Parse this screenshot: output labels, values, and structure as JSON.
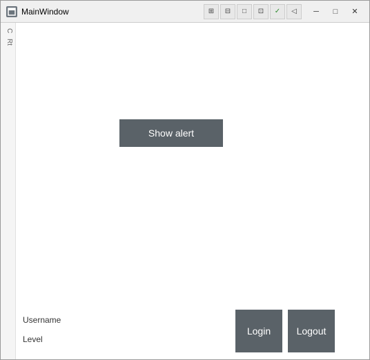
{
  "window": {
    "title": "MainWindow",
    "icon": "window-icon"
  },
  "toolbar": {
    "buttons": [
      {
        "label": "⊞",
        "name": "toolbar-btn-1"
      },
      {
        "label": "⊟",
        "name": "toolbar-btn-2"
      },
      {
        "label": "□",
        "name": "toolbar-btn-3"
      },
      {
        "label": "⊡",
        "name": "toolbar-btn-4"
      },
      {
        "label": "✓",
        "name": "toolbar-btn-check"
      },
      {
        "label": "◁",
        "name": "toolbar-btn-arrow"
      }
    ]
  },
  "controls": {
    "minimize": "─",
    "maximize": "□",
    "close": "✕"
  },
  "main": {
    "show_alert_label": "Show alert",
    "username_label": "Username",
    "level_label": "Level",
    "login_label": "Login",
    "logout_label": "Logout"
  },
  "sidebar": {
    "text1": "C",
    "text2": "Rt"
  }
}
